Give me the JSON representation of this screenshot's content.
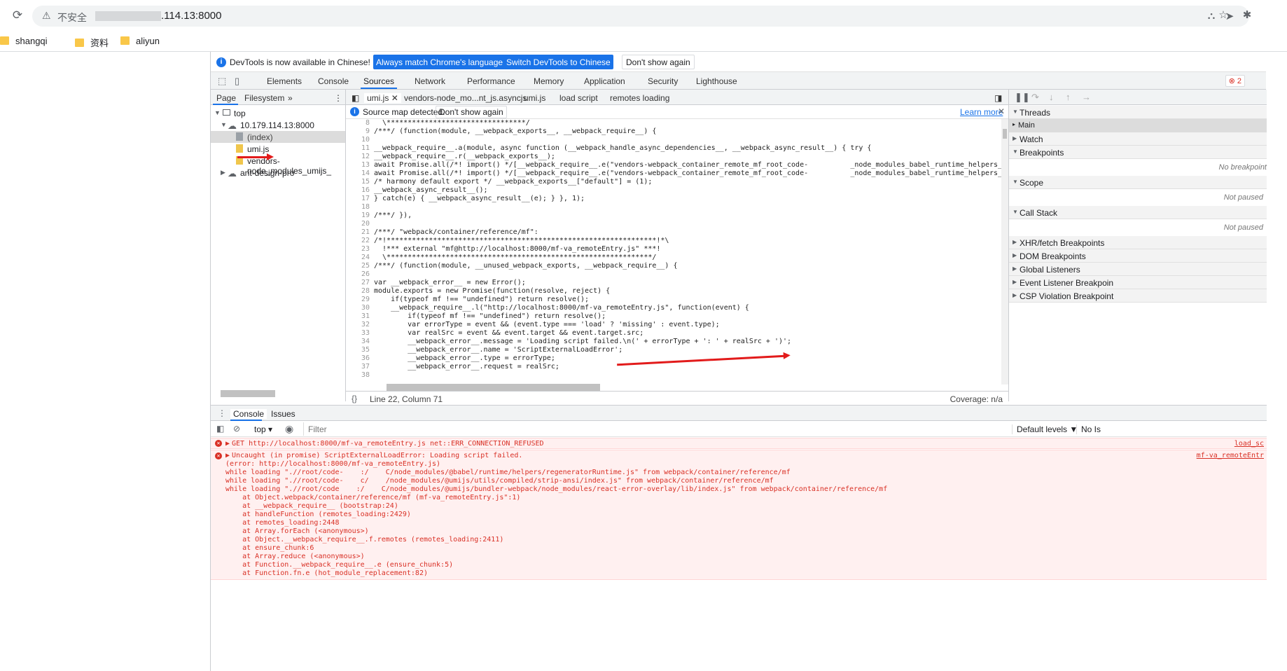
{
  "browser": {
    "insecure_label": "不安全",
    "url": ".114.13:8000",
    "bookmarks": [
      "shangqi",
      "资料",
      "aliyun"
    ]
  },
  "infobar": {
    "text": "DevTools is now available in Chinese!",
    "btn_match": "Always match Chrome's language",
    "btn_switch": "Switch DevTools to Chinese",
    "btn_dont_show": "Don't show again"
  },
  "main_tabs": [
    "Elements",
    "Console",
    "Sources",
    "Network",
    "Performance",
    "Memory",
    "Application",
    "Security",
    "Lighthouse"
  ],
  "error_count": "2",
  "navigator": {
    "tabs": [
      "Page",
      "Filesystem"
    ],
    "tree": {
      "top": "top",
      "host": "10.179.114.13:8000",
      "index": "(index)",
      "umi": "umi.js",
      "vendors": "vendors-node_modules_umijs_",
      "antd": "ant-design-pro"
    }
  },
  "editor": {
    "tabs": [
      "umi.js",
      "vendors-node_mo...nt_js.asyncjs",
      "umi.js",
      "load script",
      "remotes loading"
    ],
    "sourcemap_text": "Source map detected.",
    "sourcemap_dont_show": "Don't show again",
    "learn_more": "Learn more",
    "status_position": "Line 22, Column 71",
    "coverage": "Coverage: n/a",
    "lines": [
      {
        "n": "8",
        "t": "  \\*********************************/"
      },
      {
        "n": "9",
        "t": "/***/ (function(module, __webpack_exports__, __webpack_require__) {"
      },
      {
        "n": "10",
        "t": ""
      },
      {
        "n": "11",
        "t": "__webpack_require__.a(module, async function (__webpack_handle_async_dependencies__, __webpack_async_result__) { try {"
      },
      {
        "n": "12",
        "t": "__webpack_require__.r(__webpack_exports__);"
      },
      {
        "n": "13",
        "t": "await Promise.all(/*! import() */[__webpack_require__.e(\"vendors-webpack_container_remote_mf_root_code-          _node_modules_babel_runtime_helpers_re-4d2e00\")"
      },
      {
        "n": "14",
        "t": "await Promise.all(/*! import() */[__webpack_require__.e(\"vendors-webpack_container_remote_mf_root_code-          _node_modules_babel_runtime_helpers_re-4d2e00\")"
      },
      {
        "n": "15",
        "t": "/* harmony default export */ __webpack_exports__[\"default\"] = (1);"
      },
      {
        "n": "16",
        "t": "__webpack_async_result__();"
      },
      {
        "n": "17",
        "t": "} catch(e) { __webpack_async_result__(e); } }, 1);"
      },
      {
        "n": "18",
        "t": ""
      },
      {
        "n": "19",
        "t": "/***/ }),"
      },
      {
        "n": "20",
        "t": ""
      },
      {
        "n": "21",
        "t": "/***/ \"webpack/container/reference/mf\":"
      },
      {
        "n": "22",
        "t": "/*!****************************************************************!*\\"
      },
      {
        "n": "23",
        "t": "  !*** external \"mf@http://localhost:8000/mf-va_remoteEntry.js\" ***!"
      },
      {
        "n": "24",
        "t": "  \\***************************************************************/"
      },
      {
        "n": "25",
        "t": "/***/ (function(module, __unused_webpack_exports, __webpack_require__) {"
      },
      {
        "n": "26",
        "t": ""
      },
      {
        "n": "27",
        "t": "var __webpack_error__ = new Error();"
      },
      {
        "n": "28",
        "t": "module.exports = new Promise(function(resolve, reject) {"
      },
      {
        "n": "29",
        "t": "    if(typeof mf !== \"undefined\") return resolve();"
      },
      {
        "n": "30",
        "t": "    __webpack_require__.l(\"http://localhost:8000/mf-va_remoteEntry.js\", function(event) {"
      },
      {
        "n": "31",
        "t": "        if(typeof mf !== \"undefined\") return resolve();"
      },
      {
        "n": "32",
        "t": "        var errorType = event && (event.type === 'load' ? 'missing' : event.type);"
      },
      {
        "n": "33",
        "t": "        var realSrc = event && event.target && event.target.src;"
      },
      {
        "n": "34",
        "t": "        __webpack_error__.message = 'Loading script failed.\\n(' + errorType + ': ' + realSrc + ')';"
      },
      {
        "n": "35",
        "t": "        __webpack_error__.name = 'ScriptExternalLoadError';"
      },
      {
        "n": "36",
        "t": "        __webpack_error__.type = errorType;"
      },
      {
        "n": "37",
        "t": "        __webpack_error__.request = realSrc;"
      },
      {
        "n": "38",
        "t": ""
      }
    ]
  },
  "debugger": {
    "panes": [
      {
        "label": "Threads",
        "expanded": true
      },
      {
        "label": "Watch",
        "expanded": false
      },
      {
        "label": "Breakpoints",
        "expanded": true
      },
      {
        "label": "Scope",
        "expanded": true
      },
      {
        "label": "Call Stack",
        "expanded": true
      },
      {
        "label": "XHR/fetch Breakpoints",
        "expanded": false
      },
      {
        "label": "DOM Breakpoints",
        "expanded": false
      },
      {
        "label": "Global Listeners",
        "expanded": false
      },
      {
        "label": "Event Listener Breakpoin",
        "expanded": false
      },
      {
        "label": "CSP Violation Breakpoint",
        "expanded": false
      }
    ],
    "thread_main": "Main",
    "no_breakpoints": "No breakpoint",
    "scope_status": "Not paused",
    "callstack_status": "Not paused"
  },
  "drawer": {
    "tabs": [
      "Console",
      "Issues"
    ],
    "context": "top",
    "filter_placeholder": "Filter",
    "default_levels": "Default levels ▼",
    "no_issues": "No Is"
  },
  "console": {
    "msg1": {
      "text": "GET http://localhost:8000/mf-va_remoteEntry.js net::ERR_CONNECTION_REFUSED",
      "source": "load_sc"
    },
    "msg2": {
      "source": "mf-va_remoteEntr",
      "lines": [
        "Uncaught (in promise) ScriptExternalLoadError: Loading script failed.",
        "(error: http://localhost:8000/mf-va_remoteEntry.js)",
        "while loading \".//root/code-    :/    C/node_modules/@babel/runtime/helpers/regeneratorRuntime.js\" from webpack/container/reference/mf",
        "while loading \".//root/code-    c/    /node_modules/@umijs/utils/compiled/strip-ansi/index.js\" from webpack/container/reference/mf",
        "while loading \".//root/code    :/    C/node_modules/@umijs/bundler-webpack/node_modules/react-error-overlay/lib/index.js\" from webpack/container/reference/mf",
        "    at Object.webpack/container/reference/mf (mf-va_remoteEntry.js\":1)",
        "    at __webpack_require__ (bootstrap:24)",
        "    at handleFunction (remotes_loading:2429)",
        "    at remotes_loading:2448",
        "    at Array.forEach (<anonymous>)",
        "    at Object.__webpack_require__.f.remotes (remotes_loading:2411)",
        "    at ensure_chunk:6",
        "    at Array.reduce (<anonymous>)",
        "    at Function.__webpack_require__.e (ensure_chunk:5)",
        "    at Function.fn.e (hot_module_replacement:82)"
      ]
    }
  }
}
